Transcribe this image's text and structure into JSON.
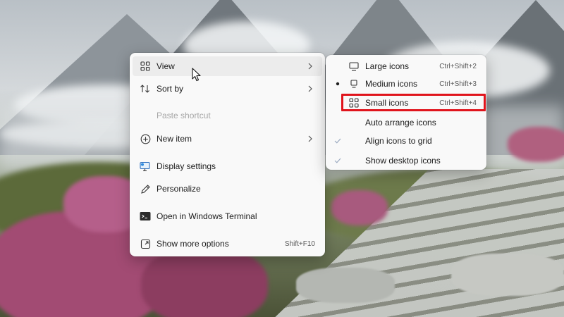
{
  "context_menu": {
    "items": [
      {
        "label": "View",
        "icon": "view-grid-icon",
        "submenu": true
      },
      {
        "label": "Sort by",
        "icon": "sort-icon",
        "submenu": true
      },
      {
        "label": "Paste shortcut",
        "disabled": true
      },
      {
        "label": "New item",
        "icon": "new-item-plus-icon",
        "submenu": true
      },
      {
        "label": "Display settings",
        "icon": "display-settings-icon"
      },
      {
        "label": "Personalize",
        "icon": "personalize-pen-icon"
      },
      {
        "label": "Open in Windows Terminal",
        "icon": "terminal-icon"
      },
      {
        "label": "Show more options",
        "icon": "more-options-icon",
        "shortcut": "Shift+F10"
      }
    ]
  },
  "view_submenu": {
    "items": [
      {
        "label": "Large icons",
        "icon": "large-icons-icon",
        "shortcut": "Ctrl+Shift+2"
      },
      {
        "label": "Medium icons",
        "icon": "medium-icons-icon",
        "shortcut": "Ctrl+Shift+3",
        "selected": true
      },
      {
        "label": "Small icons",
        "icon": "small-icons-icon",
        "shortcut": "Ctrl+Shift+4",
        "highlighted": true
      },
      {
        "label": "Auto arrange icons",
        "checked": false
      },
      {
        "label": "Align icons to grid",
        "checked": true
      },
      {
        "label": "Show desktop icons",
        "checked": true
      }
    ]
  },
  "colors": {
    "menu_background": "#f9f9f9",
    "hover_background": "#ececec",
    "highlight_border": "#e0141c",
    "disabled_text": "#a6a6a6",
    "checkmark": "#9aa9c0"
  }
}
